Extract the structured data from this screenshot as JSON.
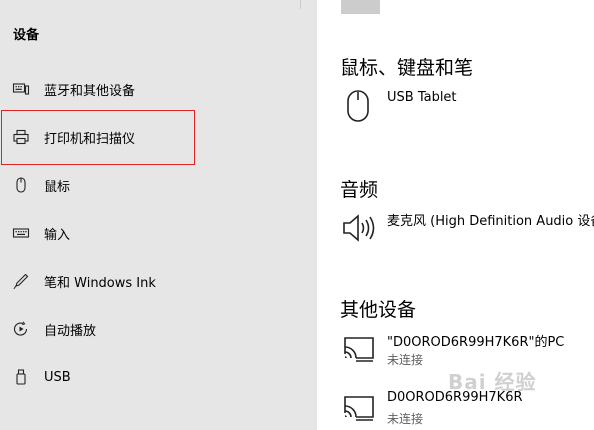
{
  "sidebar": {
    "section_title": "设备",
    "items": [
      {
        "label": "蓝牙和其他设备",
        "icon": "bluetooth-devices-icon"
      },
      {
        "label": "打印机和扫描仪",
        "icon": "printer-icon"
      },
      {
        "label": "鼠标",
        "icon": "mouse-icon"
      },
      {
        "label": "输入",
        "icon": "keyboard-icon"
      },
      {
        "label": "笔和 Windows Ink",
        "icon": "pen-icon"
      },
      {
        "label": "自动播放",
        "icon": "autoplay-icon"
      },
      {
        "label": "USB",
        "icon": "usb-icon"
      }
    ]
  },
  "main": {
    "sections": [
      {
        "heading": "鼠标、键盘和笔",
        "devices": [
          {
            "name": "USB Tablet",
            "icon": "mouse-icon"
          }
        ]
      },
      {
        "heading": "音频",
        "devices": [
          {
            "name": "麦克风 (High Definition Audio 设备",
            "icon": "speaker-icon"
          }
        ]
      },
      {
        "heading": "其他设备",
        "devices": [
          {
            "name": "\"D0OROD6R99H7K6R\"的PC",
            "status": "未连接",
            "icon": "wireless-display-icon"
          },
          {
            "name": "D0OROD6R99H7K6R",
            "status": "未连接",
            "icon": "wireless-display-icon"
          }
        ]
      }
    ]
  },
  "watermark": "Bai 经验",
  "colors": {
    "sidebar_bg": "#e6e6e6",
    "highlight_border": "#e02424",
    "status_text": "#5f5f5f"
  }
}
